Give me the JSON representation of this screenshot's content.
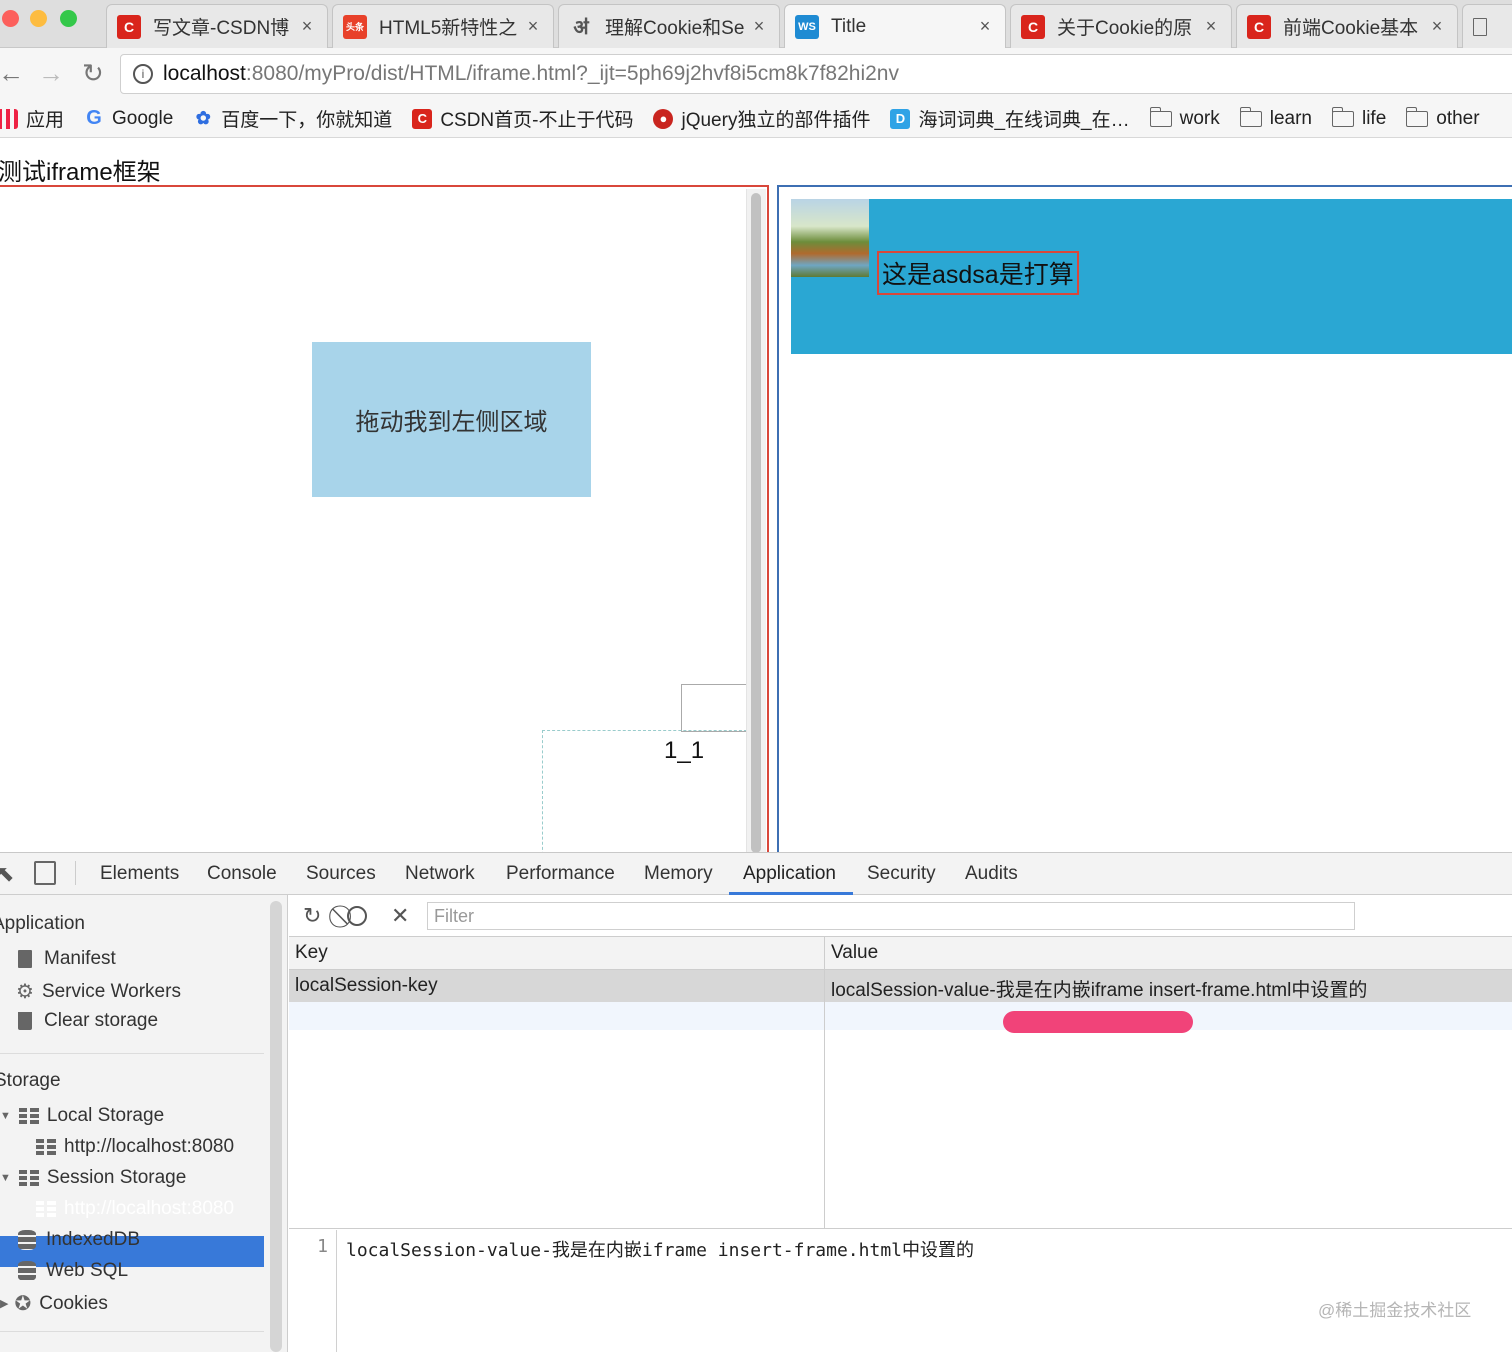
{
  "browser": {
    "tabs": [
      {
        "label": "写文章-CSDN博",
        "icon": "csdn-icon",
        "color": "#d9251c"
      },
      {
        "label": "HTML5新特性之",
        "icon": "toutiao-icon",
        "color": "#e8412a"
      },
      {
        "label": "理解Cookie和Se",
        "icon": "jianshu-icon",
        "color": "#555555"
      },
      {
        "label": "Title",
        "icon": "webstorm-icon",
        "color": "#1f8bd3"
      },
      {
        "label": "关于Cookie的原",
        "icon": "csdn-icon",
        "color": "#d9251c"
      },
      {
        "label": "前端Cookie基本",
        "icon": "csdn-icon",
        "color": "#d9251c"
      }
    ],
    "active_tab": "Title",
    "close_glyph": "×",
    "url_host": "localhost",
    "url_rest": ":8080/myPro/dist/HTML/iframe.html?_ijt=5ph69j2hvf8i5cm8k7f82hi2nv",
    "bookmarks": [
      {
        "label": "应用",
        "icon": "apps-icon"
      },
      {
        "label": "Google",
        "icon": "google-icon"
      },
      {
        "label": "百度一下，你就知道",
        "icon": "baidu-icon"
      },
      {
        "label": "CSDN首页-不止于代码",
        "icon": "csdn-icon"
      },
      {
        "label": "jQuery独立的部件插件",
        "icon": "jquery-icon"
      },
      {
        "label": "海词词典_在线词典_在…",
        "icon": "dict-icon"
      },
      {
        "label": "work",
        "icon": "folder-icon"
      },
      {
        "label": "learn",
        "icon": "folder-icon"
      },
      {
        "label": "life",
        "icon": "folder-icon"
      },
      {
        "label": "other",
        "icon": "folder-icon"
      }
    ]
  },
  "page": {
    "heading": "测试iframe框架",
    "drag_box_text": "拖动我到左侧区域",
    "dashed_label": "1_1",
    "banner_text": "这是asdsa是打算"
  },
  "devtools": {
    "tabs": [
      "Elements",
      "Console",
      "Sources",
      "Network",
      "Performance",
      "Memory",
      "Application",
      "Security",
      "Audits"
    ],
    "active_tab": "Application",
    "sidebar": {
      "application_header": "Application",
      "application_items": [
        "Manifest",
        "Service Workers",
        "Clear storage"
      ],
      "storage_header": "Storage",
      "local_storage": "Local Storage",
      "local_storage_child": "http://localhost:8080",
      "session_storage": "Session Storage",
      "session_storage_child": "http://localhost:8080",
      "indexeddb": "IndexedDB",
      "websql": "Web SQL",
      "cookies": "Cookies"
    },
    "filter_placeholder": "Filter",
    "table": {
      "key_header": "Key",
      "value_header": "Value",
      "rows": [
        {
          "key": "localSession-key",
          "value": "localSession-value-我是在内嵌iframe insert-frame.html中设置的"
        }
      ]
    },
    "preview": {
      "line_number": "1",
      "text": "localSession-value-我是在内嵌iframe insert-frame.html中设置的"
    }
  },
  "watermark": "@稀土掘金技术社区"
}
